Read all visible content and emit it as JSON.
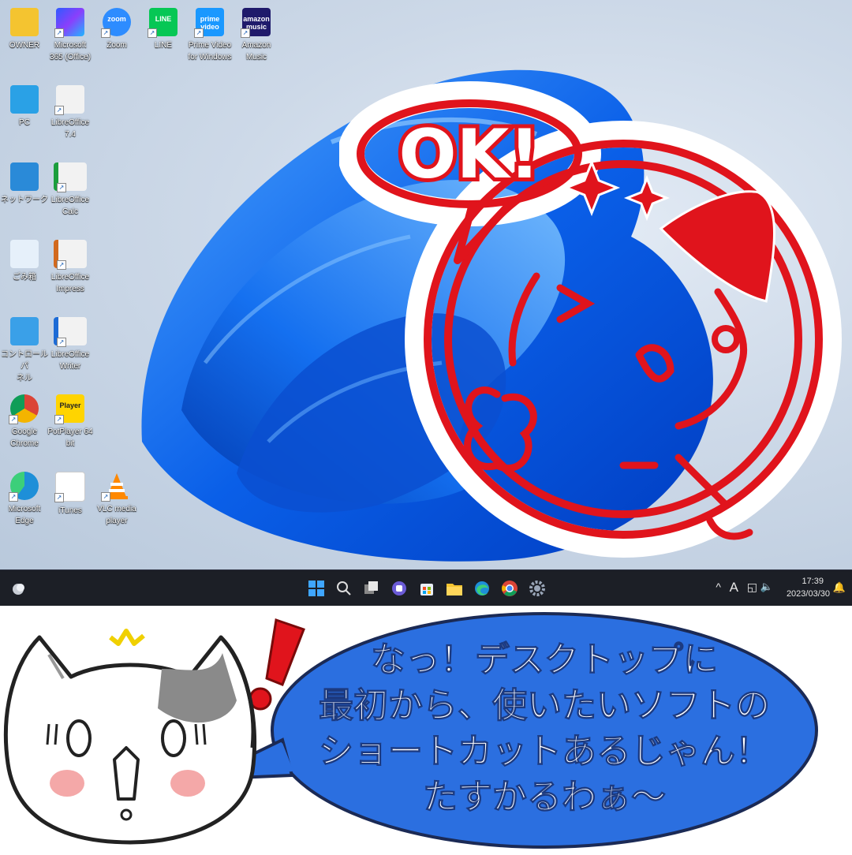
{
  "desktop": {
    "icons": [
      {
        "label": "OWNER",
        "icon": "folder-icon"
      },
      {
        "label": "Microsoft\n365 (Office)",
        "icon": "microsoft-365-icon"
      },
      {
        "label": "Zoom",
        "icon": "zoom-icon",
        "glyph_text": "zoom"
      },
      {
        "label": "LINE",
        "icon": "line-icon",
        "glyph_text": "LINE"
      },
      {
        "label": "Prime Video\nfor Windows",
        "icon": "prime-video-icon",
        "glyph_text": "prime\nvideo"
      },
      {
        "label": "Amazon\nMusic",
        "icon": "amazon-music-icon",
        "glyph_text": "amazon\nmusic"
      },
      {
        "label": "PC",
        "icon": "pc-icon"
      },
      {
        "label": "LibreOffice\n7.4",
        "icon": "libreoffice-icon"
      },
      {
        "label": "ネットワーク",
        "icon": "network-icon"
      },
      {
        "label": "LibreOffice\nCalc",
        "icon": "libreoffice-calc-icon"
      },
      {
        "label": "ごみ箱",
        "icon": "recycle-bin-icon"
      },
      {
        "label": "LibreOffice\nImpress",
        "icon": "libreoffice-impress-icon"
      },
      {
        "label": "コントロール パ\nネル",
        "icon": "control-panel-icon"
      },
      {
        "label": "LibreOffice\nWriter",
        "icon": "libreoffice-writer-icon"
      },
      {
        "label": "Google\nChrome",
        "icon": "chrome-icon"
      },
      {
        "label": "PotPlayer 64\nbit",
        "icon": "potplayer-icon",
        "glyph_text": "Player"
      },
      {
        "label": "Microsoft\nEdge",
        "icon": "edge-icon"
      },
      {
        "label": "iTunes",
        "icon": "itunes-icon"
      },
      {
        "label": "VLC media\nplayer",
        "icon": "vlc-icon"
      }
    ]
  },
  "taskbar": {
    "time": "17:39",
    "date": "2023/03/30",
    "ime": "A",
    "pinned": [
      "start-icon",
      "search-icon",
      "task-view-icon",
      "teams-chat-icon",
      "store-icon",
      "file-explorer-icon",
      "edge-icon",
      "chrome-icon",
      "settings-icon"
    ]
  },
  "stamp": {
    "text": "OK!",
    "color": "#e0141c"
  },
  "bubble": {
    "lines": [
      "なっ！デスクトップに",
      "最初から、使いたいソフトの",
      "ショートカットあるじゃん！",
      "たすかるわぁ〜"
    ],
    "color": "#2b6fe0"
  }
}
